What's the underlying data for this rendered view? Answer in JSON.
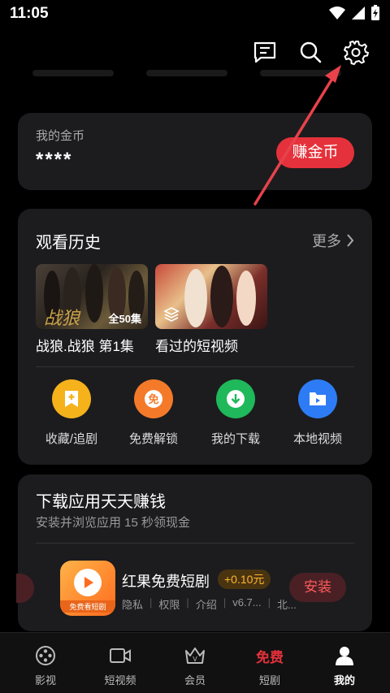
{
  "status_bar": {
    "time": "11:05"
  },
  "topbar": {
    "icons": [
      "message-icon",
      "search-icon",
      "settings-icon"
    ]
  },
  "coins": {
    "label": "我的金币",
    "value": "****",
    "earn_button": "赚金币"
  },
  "history": {
    "title": "观看历史",
    "more": "更多",
    "items": [
      {
        "title": "战狼.战狼 第1集",
        "badge": "全50集"
      },
      {
        "title": "看过的短视频",
        "badge": ""
      }
    ],
    "shortcuts": [
      {
        "label": "收藏/追剧",
        "icon": "bookmark-plus-icon",
        "color": "#f5b21b"
      },
      {
        "label": "免费解锁",
        "icon": "free-icon",
        "color": "#f47a2a"
      },
      {
        "label": "我的下载",
        "icon": "download-icon",
        "color": "#1fb85a"
      },
      {
        "label": "本地视频",
        "icon": "folder-icon",
        "color": "#2d7cf5"
      }
    ]
  },
  "download_section": {
    "title": "下载应用天天赚钱",
    "subtitle": "安装并浏览应用 15 秒领现金",
    "app": {
      "name": "红果免费短剧",
      "reward": "+0.10元",
      "icon_caption": "免费看短剧",
      "meta": [
        "隐私",
        "权限",
        "介绍",
        "v6.7...",
        "北..."
      ],
      "install_button": "安装"
    }
  },
  "bottom_nav": {
    "items": [
      {
        "label": "影视",
        "icon": "film-reel-icon"
      },
      {
        "label": "短视频",
        "icon": "video-camera-icon"
      },
      {
        "label": "会员",
        "icon": "crown-icon"
      },
      {
        "label": "短剧",
        "icon": "free-text-icon",
        "icon_text": "免费"
      },
      {
        "label": "我的",
        "icon": "user-icon"
      }
    ],
    "active": "我的"
  },
  "colors": {
    "accent": "#e5313b",
    "card": "#1c1c1e",
    "background": "#000000"
  }
}
